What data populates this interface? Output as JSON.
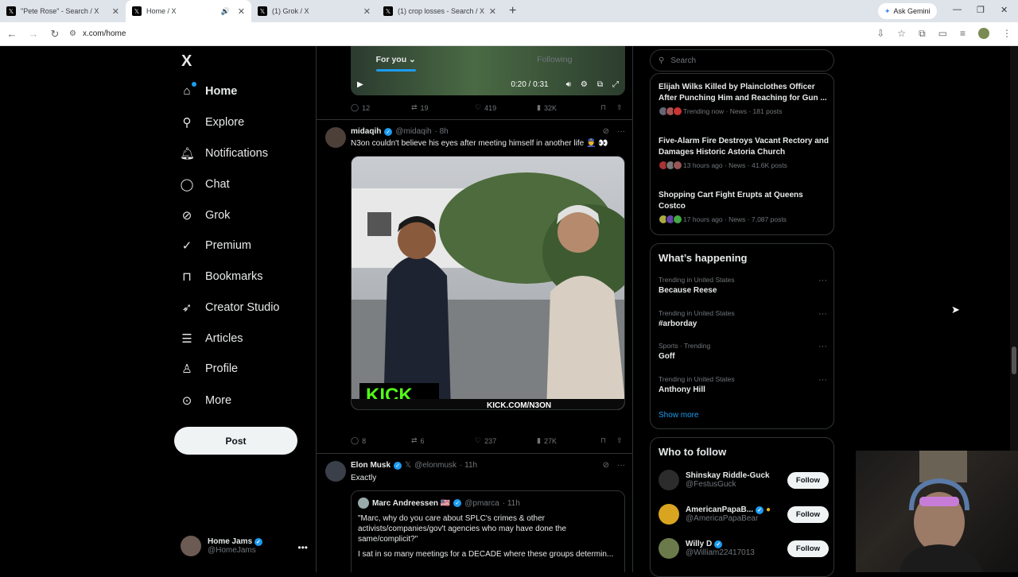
{
  "browser": {
    "tabs": [
      {
        "title": "\"Pete Rose\" - Search / X",
        "active": false
      },
      {
        "title": "Home / X",
        "active": true
      },
      {
        "title": "(1) Grok / X",
        "active": false
      },
      {
        "title": "(1) crop losses - Search / X",
        "active": false
      }
    ],
    "new_tab": "+",
    "ask_gemini": "Ask Gemini",
    "url": "x.com/home"
  },
  "sidebar": {
    "logo": "X",
    "items": [
      {
        "label": "Home",
        "icon": "home-icon"
      },
      {
        "label": "Explore",
        "icon": "search-icon"
      },
      {
        "label": "Notifications",
        "icon": "bell-icon"
      },
      {
        "label": "Chat",
        "icon": "chat-icon"
      },
      {
        "label": "Grok",
        "icon": "grok-icon"
      },
      {
        "label": "Premium",
        "icon": "premium-icon"
      },
      {
        "label": "Bookmarks",
        "icon": "bookmark-icon"
      },
      {
        "label": "Creator Studio",
        "icon": "rocket-icon"
      },
      {
        "label": "Articles",
        "icon": "articles-icon"
      },
      {
        "label": "Profile",
        "icon": "person-icon"
      },
      {
        "label": "More",
        "icon": "more-circle-icon"
      }
    ],
    "post_label": "Post",
    "account": {
      "name": "Home Jams",
      "handle": "@HomeJams"
    }
  },
  "feed": {
    "tabs": [
      "For you",
      "Following"
    ],
    "video_time": "0:20 / 0:31",
    "tweet0_stats": {
      "replies": "12",
      "reposts": "19",
      "likes": "419",
      "views": "32K"
    },
    "tweet1": {
      "name": "midaqih",
      "handle": "@midaqih",
      "time": "· 8h",
      "text": "N3on couldn't believe his eyes after meeting himself in another life 👮 👀",
      "media_text": "KICK.COM/N3ON",
      "media_logo": "KICK",
      "stats": {
        "replies": "8",
        "reposts": "6",
        "likes": "237",
        "views": "27K"
      }
    },
    "tweet2": {
      "name": "Elon Musk",
      "handle": "@elonmusk",
      "time": "· 11h",
      "text": "Exactly",
      "quote": {
        "name": "Marc Andreessen 🇺🇸",
        "handle": "@pmarca",
        "time": "· 11h",
        "text1": "\"Marc, why do you care about SPLC's crimes & other activists/companies/gov't agencies who may have done the same/complicit?\"",
        "text2": "I sat in so many meetings for a DECADE where these groups determin..."
      }
    }
  },
  "right": {
    "search_placeholder": "Search",
    "news": [
      {
        "title": "Elijah Wilks Killed by Plainclothes Officer After Punching Him and Reaching for Gun ...",
        "meta": "Trending now · News · 181 posts"
      },
      {
        "title": "Five-Alarm Fire Destroys Vacant Rectory and Damages Historic Astoria Church",
        "meta": "13 hours ago · News · 41.6K posts"
      },
      {
        "title": "Shopping Cart Fight Erupts at Queens Costco",
        "meta": "17 hours ago · News · 7,087 posts"
      }
    ],
    "happening_title": "What’s happening",
    "trends": [
      {
        "context": "Trending in United States",
        "name": "Because Reese"
      },
      {
        "context": "Trending in United States",
        "name": "#arborday"
      },
      {
        "context": "Sports · Trending",
        "name": "Goff"
      },
      {
        "context": "Trending in United States",
        "name": "Anthony Hill"
      }
    ],
    "show_more": "Show more",
    "who_title": "Who to follow",
    "who": [
      {
        "name": "Shinskay Riddle-Guck",
        "handle": "@FestusGuck",
        "btn": "Follow"
      },
      {
        "name": "AmericanPapaB...",
        "handle": "@AmericaPapaBear",
        "btn": "Follow"
      },
      {
        "name": "Willy D",
        "handle": "@William22417013",
        "btn": "Follow"
      }
    ]
  },
  "colors": {
    "accent": "#1d9bf0",
    "background": "#000000",
    "border": "#2f3336",
    "muted": "#71767b"
  }
}
